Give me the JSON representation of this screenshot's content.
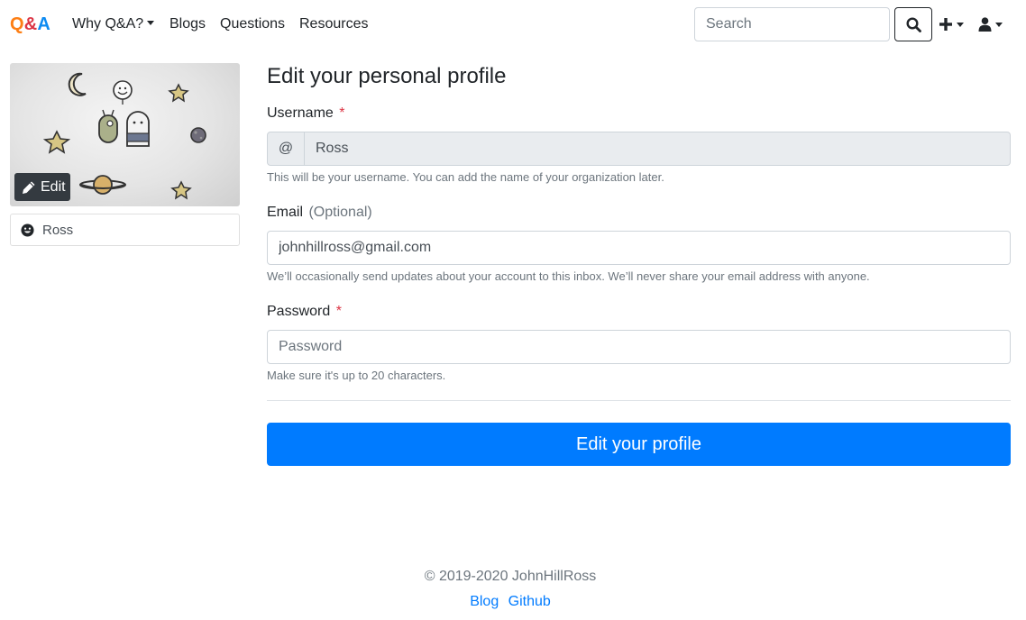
{
  "navbar": {
    "brand": {
      "q": "Q",
      "amp": "&",
      "a": "A"
    },
    "links": [
      {
        "label": "Why Q&A?",
        "has_dropdown": true
      },
      {
        "label": "Blogs"
      },
      {
        "label": "Questions"
      },
      {
        "label": "Resources"
      }
    ],
    "search_placeholder": "Search",
    "icons": [
      "search-icon",
      "plus-icon",
      "user-icon"
    ]
  },
  "sidebar": {
    "edit_label": "Edit",
    "profile_name": "Ross",
    "profile_icon": "smile-icon",
    "edit_icon": "pencil-icon"
  },
  "form": {
    "title": "Edit your personal profile",
    "username": {
      "label": "Username",
      "required_mark": "*",
      "prefix": "@",
      "value": "Ross",
      "help": "This will be your username. You can add the name of your organization later."
    },
    "email": {
      "label": "Email",
      "optional": "(Optional)",
      "value": "johnhillross@gmail.com",
      "help": "We’ll occasionally send updates about your account to this inbox. We’ll never share your email address with anyone."
    },
    "password": {
      "label": "Password",
      "required_mark": "*",
      "placeholder": "Password",
      "help": "Make sure it's up to 20 characters."
    },
    "submit_label": "Edit your profile"
  },
  "footer": {
    "copyright": "© 2019-2020 JohnHillRoss",
    "links": [
      "Blog",
      "Github"
    ]
  },
  "colors": {
    "primary": "#007bff",
    "danger": "#dc3545",
    "muted": "#6c757d",
    "dark": "#343a40",
    "brand_orange": "#fd7e14"
  }
}
